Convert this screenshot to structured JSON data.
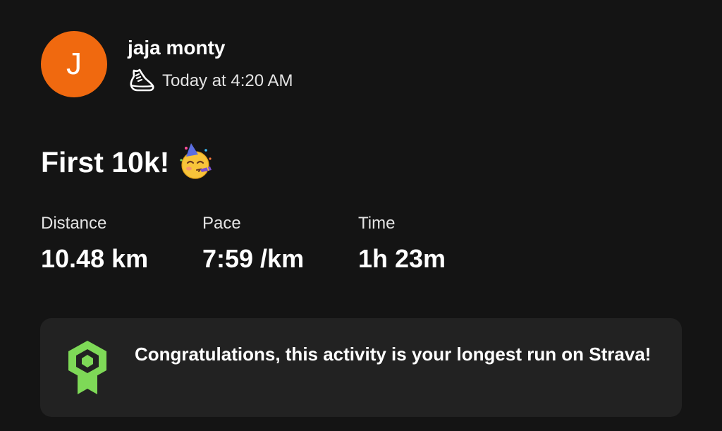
{
  "athlete": {
    "name": "jaja monty",
    "avatar_initial": "J",
    "avatar_color": "#f0690f"
  },
  "activity": {
    "sport_icon": "running-shoe-icon",
    "timestamp": "Today at 4:20 AM",
    "title": "First 10k!",
    "title_emoji": "partying-face-emoji"
  },
  "stats": {
    "distance": {
      "label": "Distance",
      "value": "10.48 km"
    },
    "pace": {
      "label": "Pace",
      "value": "7:59 /km"
    },
    "time": {
      "label": "Time",
      "value": "1h 23m"
    }
  },
  "achievement": {
    "icon": "achievement-ribbon-icon",
    "icon_color": "#7ed957",
    "text": "Congratulations, this activity is your longest run on Strava!"
  },
  "colors": {
    "background": "#141414",
    "card": "#222222",
    "text_primary": "#ffffff",
    "text_secondary": "#e4e4e4"
  }
}
